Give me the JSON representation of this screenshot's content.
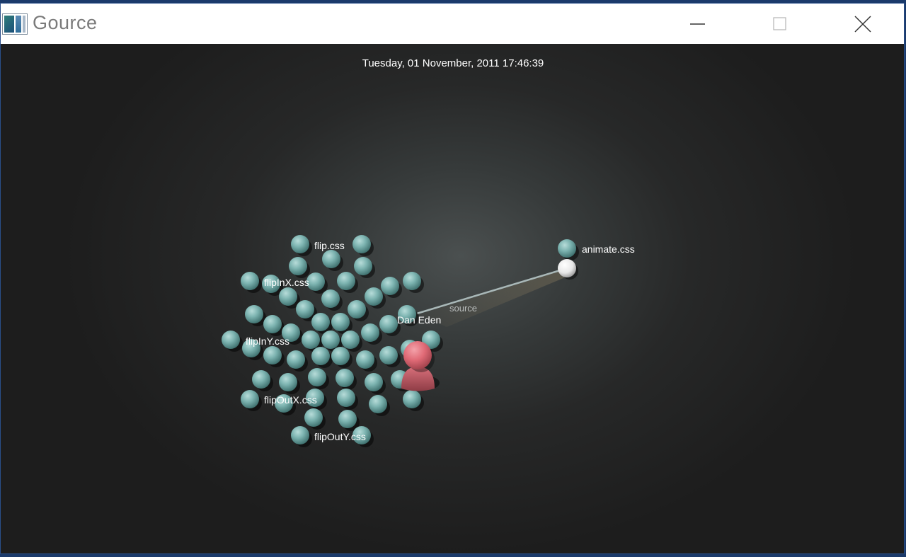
{
  "window": {
    "title": "Gource",
    "icon": "gource-app-icon",
    "controls": [
      "minimize-icon",
      "maximize-icon",
      "close-icon"
    ]
  },
  "visualization": {
    "timestamp": "Tuesday, 01 November, 2011 17:46:39",
    "colors": {
      "file_node": "#6fa9a6",
      "user": "#e06a76",
      "dir_node": "#ffffff",
      "edge": "#a9b8b8",
      "background": "#1d1d1d"
    },
    "file_labels": [
      "flip.css",
      "flipInX.css",
      "flipInY.css",
      "flipOutX.css",
      "flipOutY.css",
      "animate.css"
    ],
    "directory_label": "source",
    "user_name": "Dan Eden"
  }
}
